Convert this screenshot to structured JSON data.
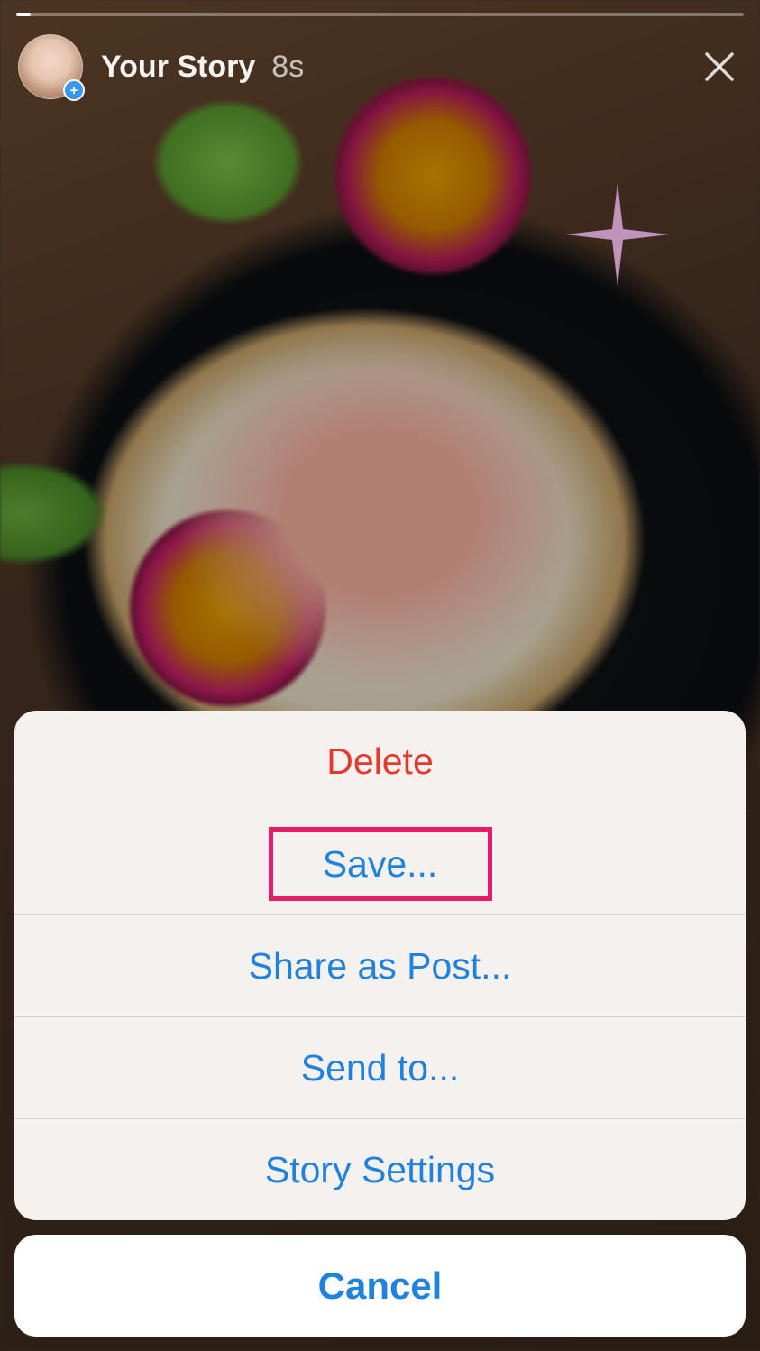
{
  "header": {
    "title": "Your Story",
    "timestamp": "8s"
  },
  "actionsheet": {
    "options": [
      {
        "label": "Delete",
        "style": "red"
      },
      {
        "label": "Save...",
        "style": "blue",
        "highlighted": true
      },
      {
        "label": "Share as Post...",
        "style": "blue"
      },
      {
        "label": "Send to...",
        "style": "blue"
      },
      {
        "label": "Story Settings",
        "style": "blue"
      }
    ],
    "cancel_label": "Cancel"
  }
}
